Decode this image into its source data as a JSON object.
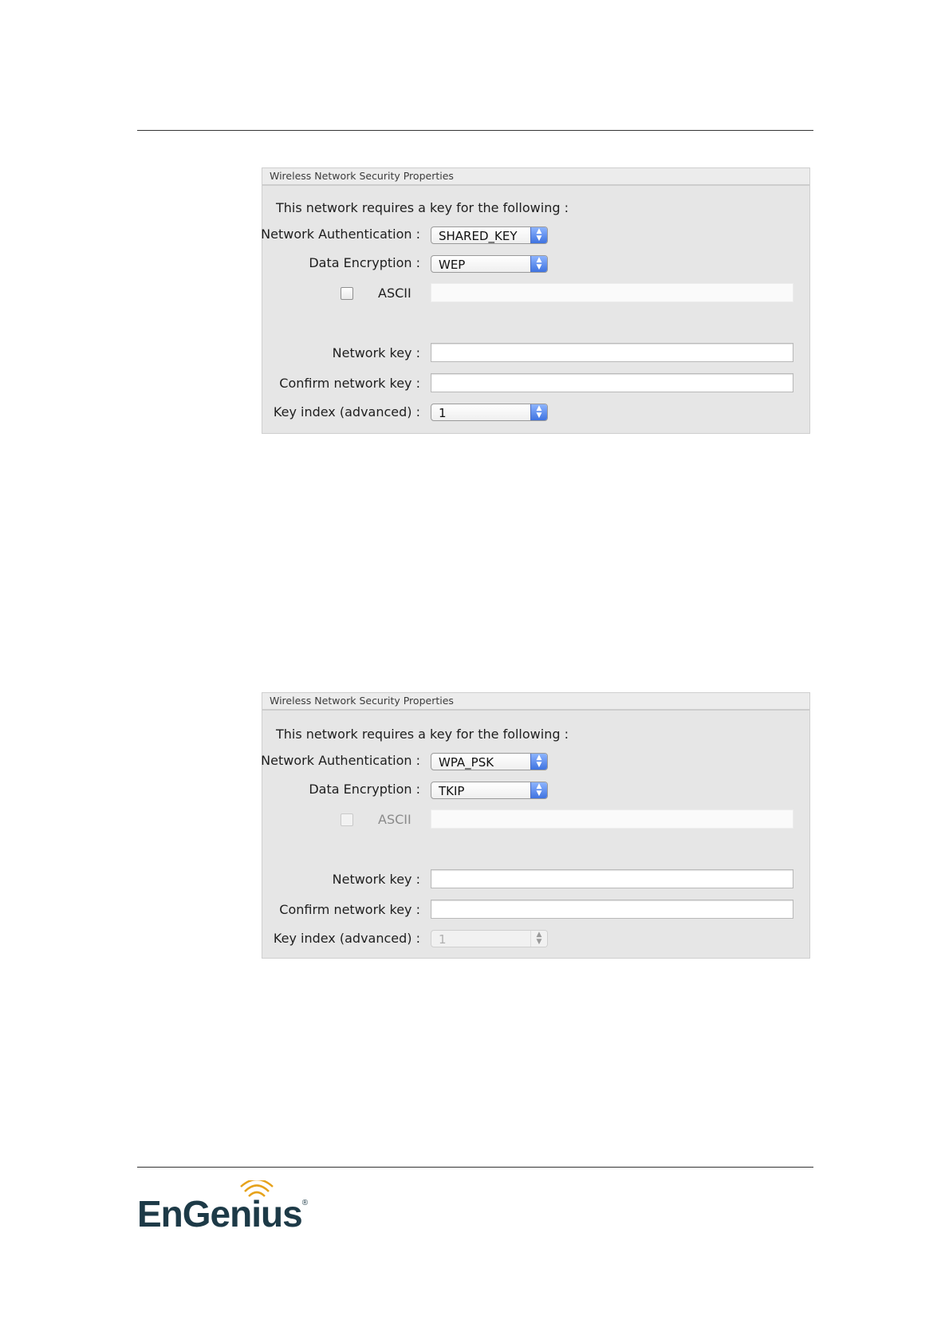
{
  "panels": [
    {
      "title": "Wireless Network Security Properties",
      "intro": "This network requires a key for the following :",
      "auth_label": "Network Authentication :",
      "auth_value": "SHARED_KEY",
      "enc_label": "Data Encryption :",
      "enc_value": "WEP",
      "ascii_label": "ASCII",
      "ascii_checked": false,
      "key_label": "Network key :",
      "key_value": "",
      "confirm_label": "Confirm network key :",
      "confirm_value": "",
      "index_label": "Key index (advanced) :",
      "index_value": "1"
    },
    {
      "title": "Wireless Network Security Properties",
      "intro": "This network requires a key for the following :",
      "auth_label": "Network Authentication :",
      "auth_value": "WPA_PSK",
      "enc_label": "Data Encryption :",
      "enc_value": "TKIP",
      "ascii_label": "ASCII",
      "ascii_checked": false,
      "key_label": "Network key :",
      "key_value": "",
      "confirm_label": "Confirm network key :",
      "confirm_value": "",
      "index_label": "Key index (advanced) :",
      "index_value": "1"
    }
  ],
  "footer": {
    "logo_text": "EnGenius",
    "logo_mark": "®",
    "logo_color": "#1d3a47",
    "accent": "#e6a21a"
  },
  "icons": {
    "select_arrows": "updown-arrows-icon",
    "logo_waves": "wifi-waves-icon"
  }
}
